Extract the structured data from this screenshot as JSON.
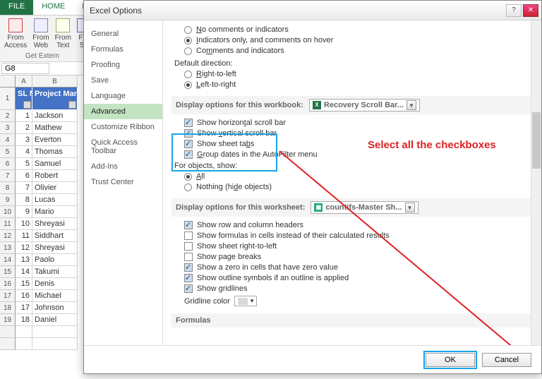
{
  "ribbon": {
    "tabs": [
      "FILE",
      "HOME",
      "IN"
    ],
    "group_items": [
      {
        "label": "From\nAccess"
      },
      {
        "label": "From\nWeb"
      },
      {
        "label": "From\nText"
      },
      {
        "label": "Fro\nSo"
      }
    ],
    "group_caption": "Get Extern"
  },
  "namebox": "G8",
  "columns": [
    "A",
    "B"
  ],
  "table": {
    "headers": [
      "SL N",
      "Project Manage"
    ],
    "rows": [
      [
        "1",
        "Jackson"
      ],
      [
        "2",
        "Mathew"
      ],
      [
        "3",
        "Everton"
      ],
      [
        "4",
        "Thomas"
      ],
      [
        "5",
        "Samuel"
      ],
      [
        "6",
        "Robert"
      ],
      [
        "7",
        "Olivier"
      ],
      [
        "8",
        "Lucas"
      ],
      [
        "9",
        "Mario"
      ],
      [
        "10",
        "Shreyasi"
      ],
      [
        "11",
        "Siddhart"
      ],
      [
        "12",
        "Shreyasi"
      ],
      [
        "13",
        "Paolo"
      ],
      [
        "14",
        "Takumi"
      ],
      [
        "15",
        "Denis"
      ],
      [
        "16",
        "Michael"
      ],
      [
        "17",
        "Johnson"
      ],
      [
        "18",
        "Daniel"
      ]
    ]
  },
  "dialog": {
    "title": "Excel Options",
    "nav": [
      "General",
      "Formulas",
      "Proofing",
      "Save",
      "Language",
      "Advanced",
      "Customize Ribbon",
      "Quick Access Toolbar",
      "Add-Ins",
      "Trust Center"
    ],
    "nav_selected": "Advanced",
    "top_radios": [
      {
        "label": "No comments or indicators",
        "u": "N",
        "on": false
      },
      {
        "label": "Indicators only, and comments on hover",
        "u": "I",
        "on": true
      },
      {
        "label": "Comments and indicators",
        "u": "m",
        "on": false
      }
    ],
    "default_direction_label": "Default direction:",
    "dir_radios": [
      {
        "label": "Right-to-left",
        "u": "R",
        "on": false
      },
      {
        "label": "Left-to-right",
        "u": "L",
        "on": true
      }
    ],
    "section_workbook": "Display options for this workbook:",
    "workbook_combo": "Recovery Scroll Bar...",
    "workbook_cbs": [
      {
        "label": "Show horizontal scroll bar",
        "u": "t",
        "on": true
      },
      {
        "label": "Show vertical scroll bar",
        "u": "v",
        "on": true
      },
      {
        "label": "Show sheet tabs",
        "u": "b",
        "on": true
      },
      {
        "label": "Group dates in the AutoFilter menu",
        "u": "G",
        "on": true
      }
    ],
    "objects_label": "For objects, show:",
    "objects_radios": [
      {
        "label": "All",
        "u": "A",
        "on": true
      },
      {
        "label": "Nothing (hide objects)",
        "u": "d",
        "on": false
      }
    ],
    "section_worksheet": "Display options for this worksheet:",
    "worksheet_combo": "countifs-Master Sh...",
    "worksheet_cbs": [
      {
        "label": "Show row and column headers",
        "on": true
      },
      {
        "label": "Show formulas in cells instead of their calculated results",
        "on": false
      },
      {
        "label": "Show sheet right-to-left",
        "on": false
      },
      {
        "label": "Show page breaks",
        "on": false
      },
      {
        "label": "Show a zero in cells that have zero value",
        "on": true
      },
      {
        "label": "Show outline symbols if an outline is applied",
        "on": true
      },
      {
        "label": "Show gridlines",
        "on": true
      }
    ],
    "gridline_label": "Gridline color",
    "section_formulas": "Formulas",
    "ok": "OK",
    "cancel": "Cancel"
  },
  "annotation": "Select all the checkboxes"
}
